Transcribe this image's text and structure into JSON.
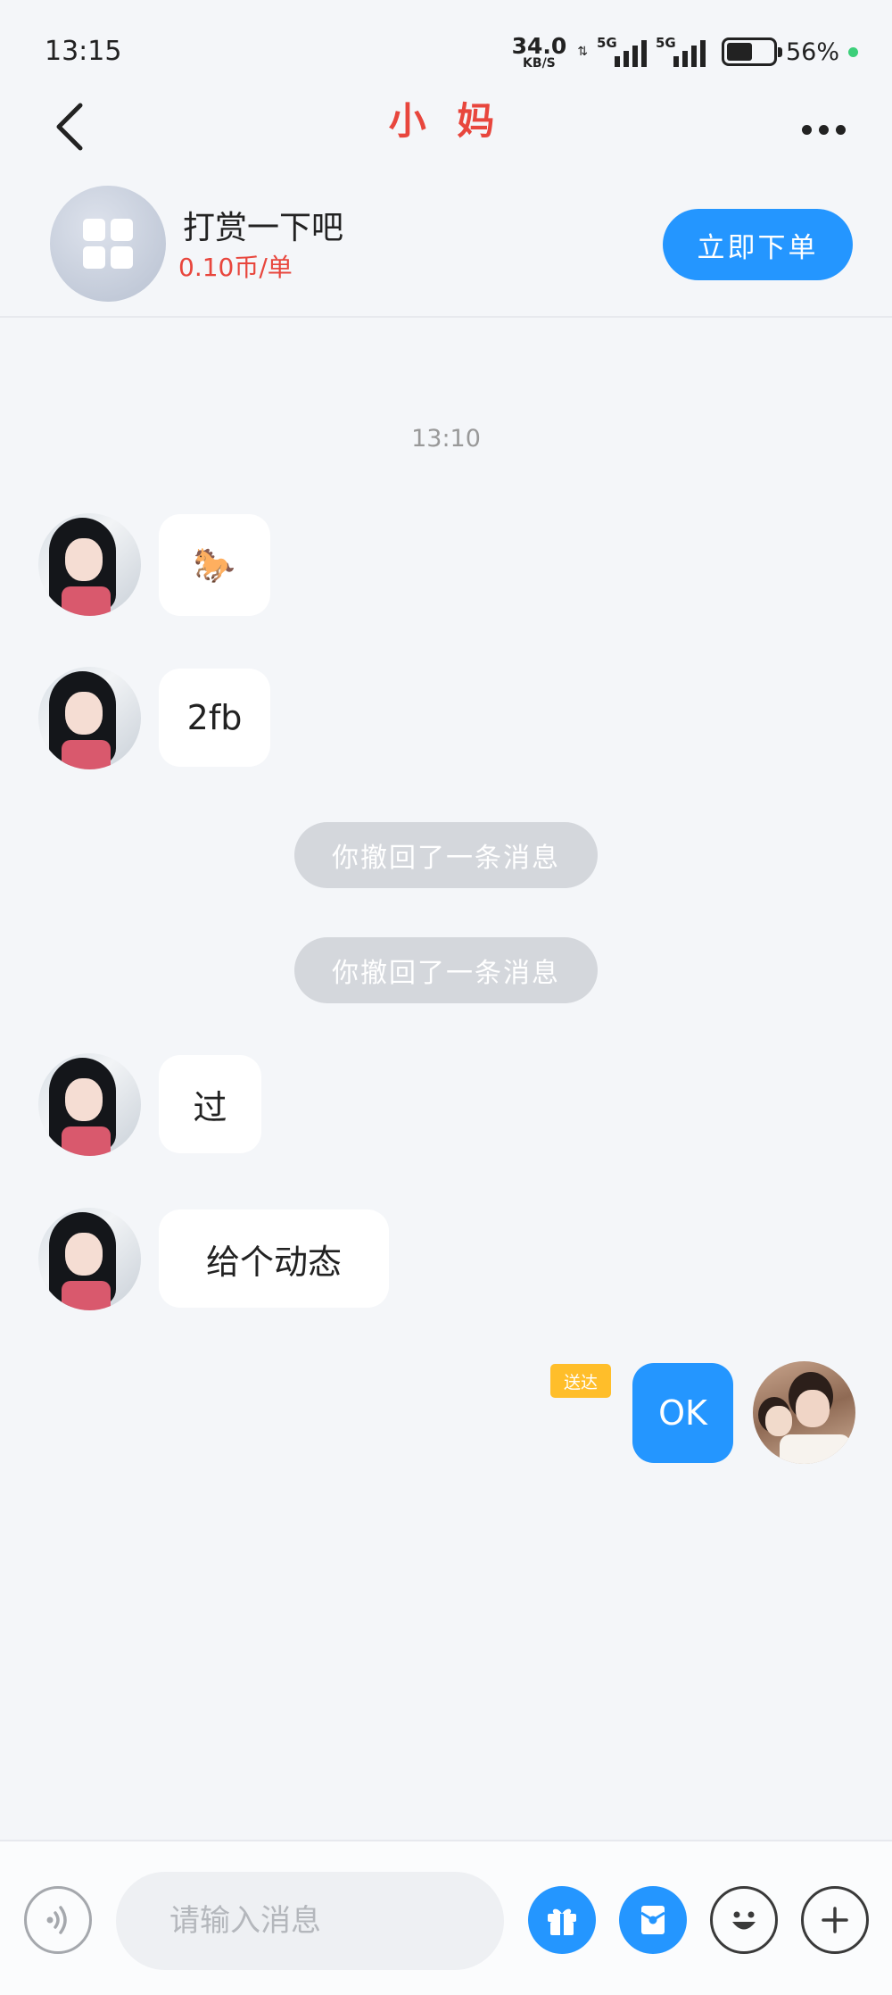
{
  "status_bar": {
    "time": "13:15",
    "net_speed": "34.0",
    "net_unit": "KB/S",
    "updown_arrows": "⇅",
    "signal1_label": "5G",
    "signal2_label": "5G",
    "battery_percent": "56%",
    "battery_level": 0.56
  },
  "header": {
    "back_icon": "chevron-left-icon",
    "title": "小 妈",
    "more_icon": "more-dots-icon"
  },
  "order_card": {
    "icon": "apps-grid-icon",
    "title": "打赏一下吧",
    "price": "0.10币/单",
    "button_label": "立即下单"
  },
  "chat": {
    "timestamp": "13:10",
    "messages": [
      {
        "from": "other",
        "text": "🐎"
      },
      {
        "from": "other",
        "text": "2fb"
      },
      {
        "from": "system",
        "text": "你撤回了一条消息"
      },
      {
        "from": "system",
        "text": "你撤回了一条消息"
      },
      {
        "from": "other",
        "text": "过"
      },
      {
        "from": "other",
        "text": "给个动态"
      },
      {
        "from": "me",
        "text": "OK",
        "status": "送达"
      }
    ]
  },
  "input_bar": {
    "placeholder": "请输入消息",
    "voice_icon": "voice-icon",
    "gift_icon": "gift-icon",
    "red_packet_icon": "red-packet-icon",
    "emoji_icon": "smile-icon",
    "plus_icon": "plus-icon"
  },
  "colors": {
    "accent": "#2496ff",
    "title_red": "#e8463d",
    "recall_bg": "#d4d7dc",
    "delivered_badge": "#ffbe2a",
    "background": "#f4f6f9"
  }
}
